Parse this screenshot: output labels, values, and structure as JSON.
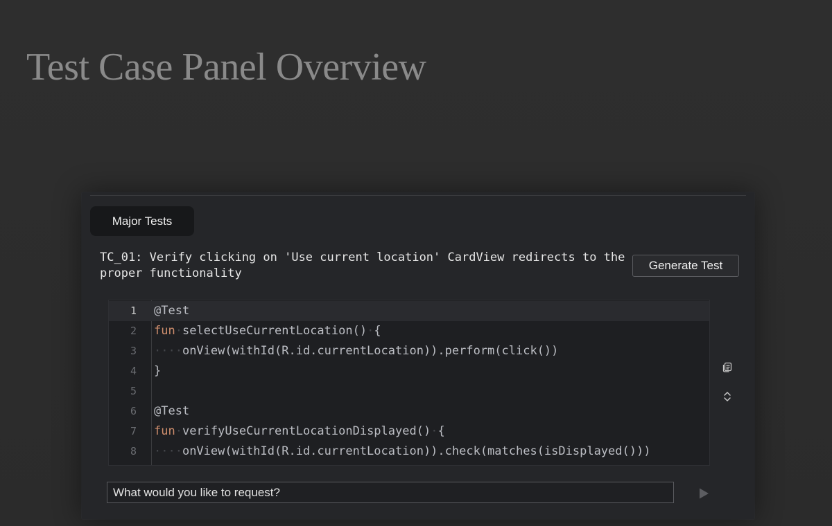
{
  "page": {
    "title": "Test Case Panel Overview"
  },
  "panel": {
    "tab_label": "Major Tests",
    "test_case_title": "TC_01: Verify clicking on 'Use current location' CardView redirects to the proper functionality",
    "generate_button_label": "Generate Test",
    "input_placeholder": "What would you like to request?",
    "icons": {
      "copy": "copy-icon",
      "expand": "expand-collapse-icon",
      "send": "send-icon"
    }
  },
  "editor": {
    "active_line": 1,
    "lines": [
      {
        "number": "1",
        "indent": "",
        "keyword": "",
        "code": "@Test"
      },
      {
        "number": "2",
        "indent": "",
        "keyword": "fun",
        "code": "selectUseCurrentLocation()·{"
      },
      {
        "number": "3",
        "indent": "····",
        "keyword": "",
        "code": "onView(withId(R.id.currentLocation)).perform(click())"
      },
      {
        "number": "4",
        "indent": "",
        "keyword": "",
        "code": "}"
      },
      {
        "number": "5",
        "indent": "",
        "keyword": "",
        "code": ""
      },
      {
        "number": "6",
        "indent": "",
        "keyword": "",
        "code": "@Test"
      },
      {
        "number": "7",
        "indent": "",
        "keyword": "fun",
        "code": "verifyUseCurrentLocationDisplayed()·{"
      },
      {
        "number": "8",
        "indent": "····",
        "keyword": "",
        "code": "onView(withId(R.id.currentLocation)).check(matches(isDisplayed()))"
      }
    ]
  },
  "colors": {
    "background": "#2b2b2b",
    "panel": "#252629",
    "editor": "#1e1f22",
    "keyword": "#cf8e6d",
    "code_text": "#bcbec4",
    "title_text": "#8a8a8a"
  }
}
